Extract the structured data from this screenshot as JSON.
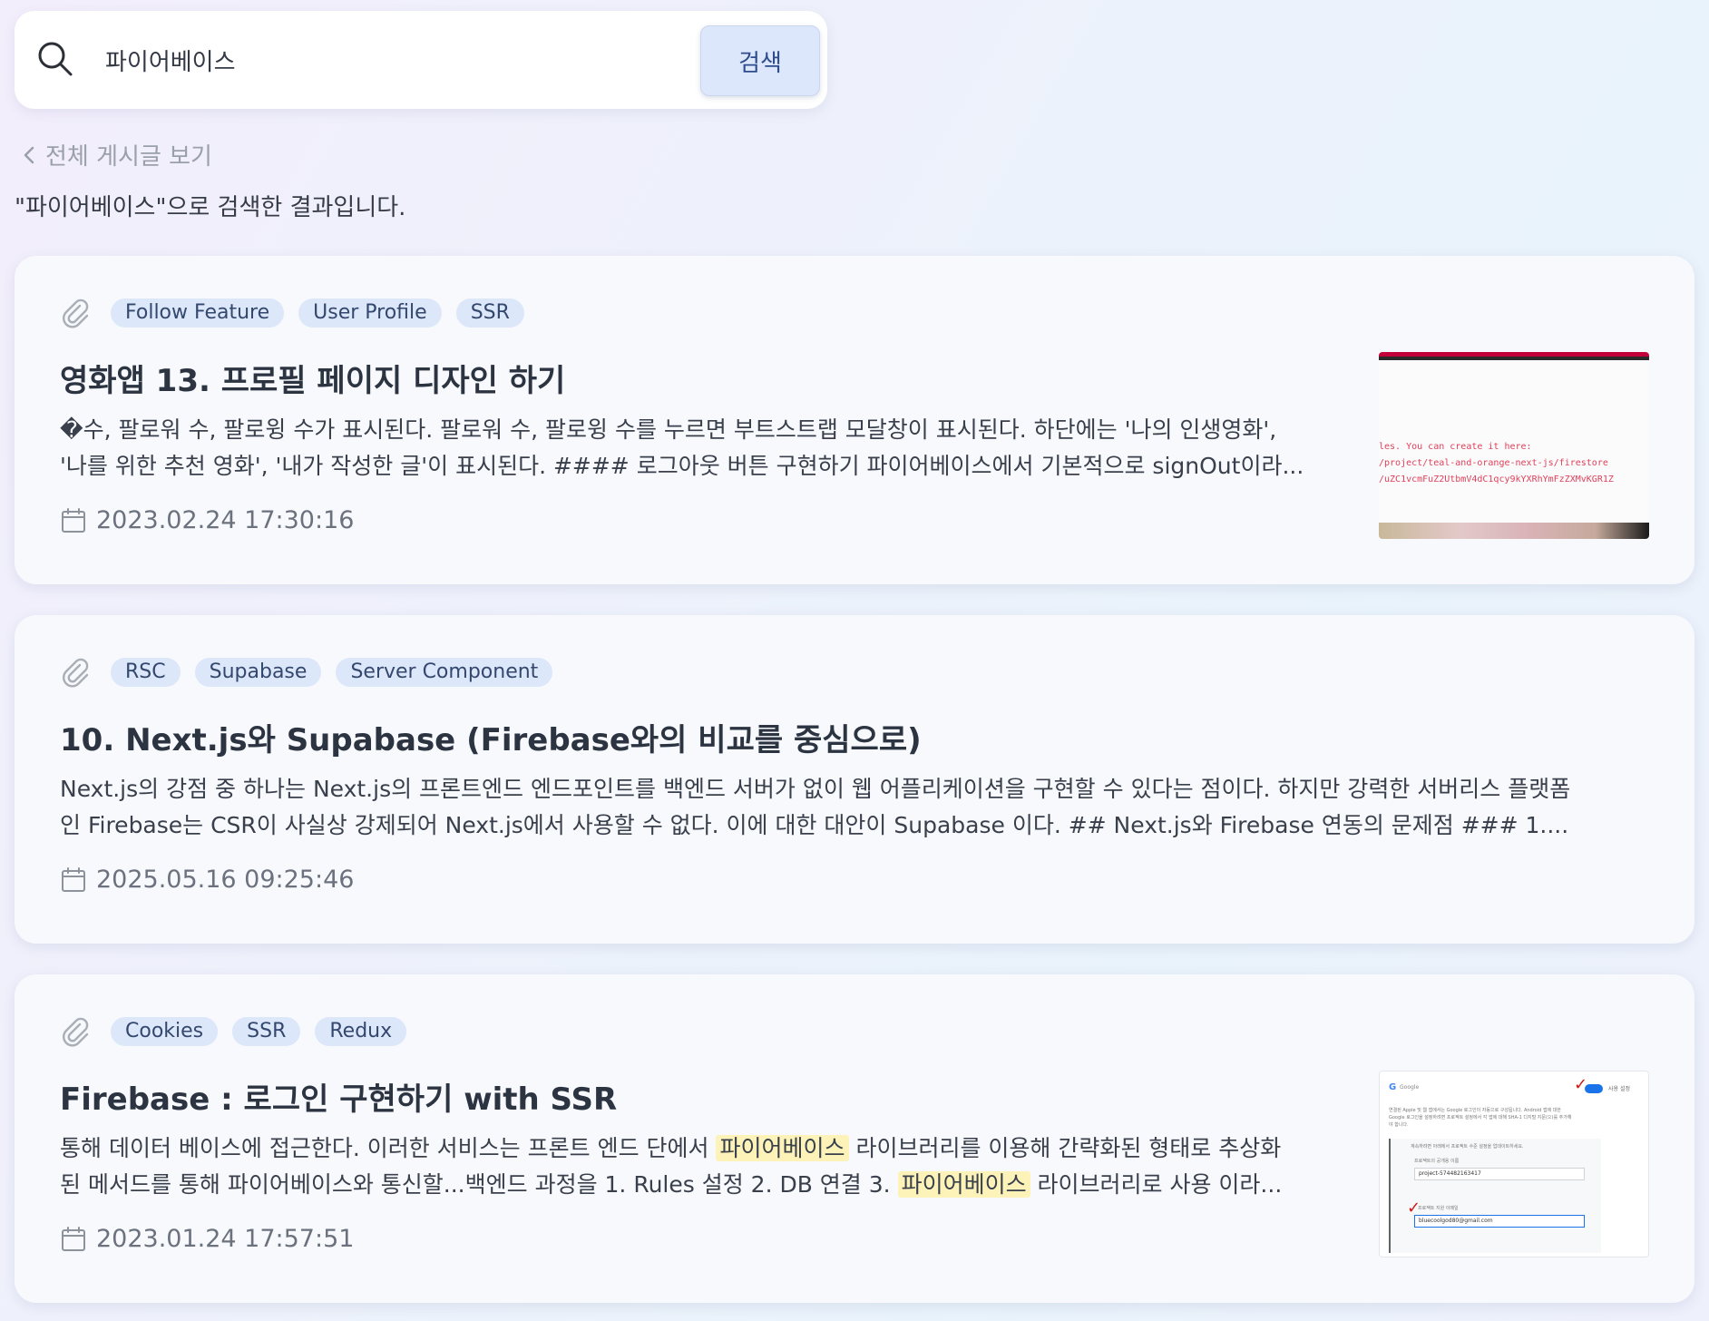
{
  "search": {
    "value": "파이어베이스",
    "button_label": "검색"
  },
  "back_link": "전체 게시글 보기",
  "caption": "\"파이어베이스\"으로 검색한 결과입니다.",
  "colors": {
    "accent": "#dce7fb",
    "tag_bg": "#dce7fa",
    "highlight": "#fdf3b8"
  },
  "results": [
    {
      "tags": [
        "Follow Feature",
        "User Profile",
        "SSR"
      ],
      "title": "영화앱 13. 프로필 페이지 디자인 하기",
      "excerpt": "�수, 팔로워 수, 팔로윙 수가 표시된다. 팔로워 수, 팔로윙 수를 누르면 부트스트랩 모달창이 표시된다. 하단에는 '나의 인생영화',\n'나를 위한 추천 영화', '내가 작성한 글'이 표시된다. #### 로그아웃 버튼 구현하기 파이어베이스에서 기본적으로 signOut이라...",
      "date": "2023.02.24 17:30:16",
      "thumbnail_lines": [
        "les. You can create it here:",
        "/project/teal-and-orange-next-js/firestore",
        "/uZC1vcmFuZ2UtbmV4dC1qcy9kYXRhYmFzZXMvKGR1Z"
      ]
    },
    {
      "tags": [
        "RSC",
        "Supabase",
        "Server Component"
      ],
      "title": "10. Next.js와 Supabase (Firebase와의 비교를 중심으로)",
      "excerpt": "Next.js의 강점 중 하나는 Next.js의 프론트엔드 엔드포인트를 백엔드 서버가 없이 웹 어플리케이션을 구현할 수 있다는 점이다. 하지만 강력한 서버리스 플랫폼\n인 Firebase는 CSR이 사실상 강제되어 Next.js에서 사용할 수 없다. 이에 대한 대안이 Supabase 이다. ## Next.js와 Firebase 연동의 문제점 ### 1....",
      "date": "2025.05.16 09:25:46"
    },
    {
      "tags": [
        "Cookies",
        "SSR",
        "Redux"
      ],
      "title": "Firebase : 로그인 구현하기 with SSR",
      "excerpt_parts": [
        "통해 데이터 베이스에 접근한다. 이러한 서비스는 프론트 엔드 단에서 ",
        "파이어베이스",
        " 라이브러리를 이용해 간략화된 형태로 추상화\n된 메서드를 통해 파이어베이스와 통신할...백엔드 과정을 1. Rules 설정 2. DB 연결 3. ",
        "파이어베이스",
        " 라이브러리로 사용 이라..."
      ],
      "date": "2023.01.24 17:57:51",
      "thumbnail_text": {
        "brand": "Google",
        "toggle_label": "사용 설정",
        "line1": "연결된 Apple 및 웹 앱에서는 Google 로그인이 자동으로 구성됩니다. Android 앱에 대한",
        "line2": "Google 로그인을 설정하려면 프로젝트 설정에서 각 앱에 대해 SHA-1 디지털 지문(으)를 추가해",
        "line3": "야 합니다.",
        "panel_line": "계속하려면 아래에서 프로젝트 수준 설정을 업데이트하세요.",
        "field1_label": "프로젝트의 공개용 이름",
        "field1_value": "project-574482163417",
        "field2_label": "프로젝트 지원 이메일",
        "field2_value": "bluecoolgod80@gmail.com"
      }
    }
  ]
}
